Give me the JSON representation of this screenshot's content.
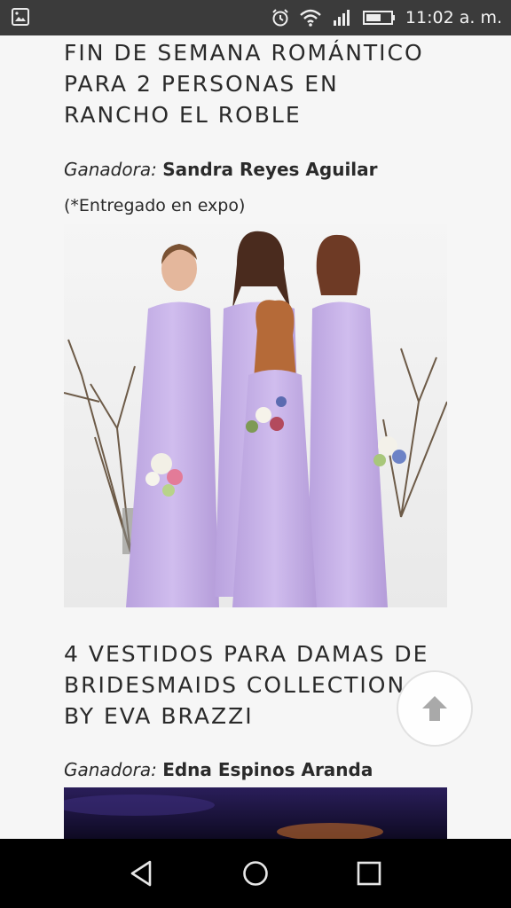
{
  "status_bar": {
    "time": "11:02 a. m.",
    "icons": [
      "gallery-icon",
      "alarm-icon",
      "wifi-icon",
      "signal-icon",
      "battery-icon"
    ]
  },
  "sections": [
    {
      "title": "FIN DE SEMANA ROMÁNTICO\nPARA 2 PERSONAS EN\nRANCHO EL ROBLE",
      "winner_label": "Ganadora:",
      "winner_name": "Sandra Reyes Aguilar",
      "note": "(*Entregado en expo)"
    },
    {
      "title": "4 VESTIDOS PARA DAMAS DE\nBRIDESMAIDS COLLECTION\nBY EVA BRAZZI",
      "winner_label": "Ganadora:",
      "winner_name": "Edna Espinos Aranda"
    }
  ],
  "colors": {
    "status_bar": "#3b3b3b",
    "background": "#f6f6f6",
    "dress": "#c7b2e6",
    "nav_bar": "#000000"
  },
  "nav_bar": {
    "buttons": [
      "back-icon",
      "home-icon",
      "recents-icon"
    ]
  }
}
